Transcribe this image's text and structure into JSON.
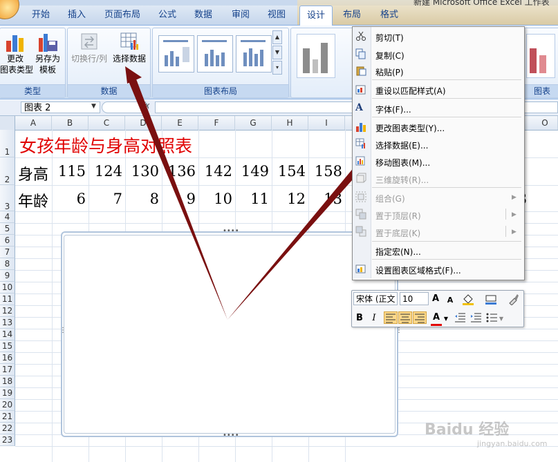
{
  "window": {
    "title_fragment": "新建 Microsoft Office Excel 工作表"
  },
  "tabs": [
    {
      "label": "开始"
    },
    {
      "label": "插入"
    },
    {
      "label": "页面布局"
    },
    {
      "label": "公式"
    },
    {
      "label": "数据"
    },
    {
      "label": "审阅"
    },
    {
      "label": "视图"
    },
    {
      "label": "设计"
    },
    {
      "label": "布局"
    },
    {
      "label": "格式"
    }
  ],
  "ribbon": {
    "type_group": {
      "label": "类型",
      "change_type": "更改\n图表类型",
      "save_template": "另存为\n模板"
    },
    "data_group": {
      "label": "数据",
      "switch_row_col": "切换行/列",
      "select_data": "选择数据"
    },
    "layout_group": {
      "label": "图表布局"
    },
    "styles_group_label_fragment": "图表"
  },
  "formula_bar": {
    "name_box": "图表 2",
    "fx": "fx",
    "value": ""
  },
  "sheet": {
    "columns": [
      "A",
      "B",
      "C",
      "D",
      "E",
      "F",
      "G",
      "H",
      "I",
      "",
      "",
      "",
      "",
      "",
      "O"
    ],
    "rows": [
      "1",
      "2",
      "3",
      "4",
      "5",
      "6",
      "7",
      "8",
      "9",
      "10",
      "11",
      "12",
      "13",
      "14",
      "15",
      "16",
      "17",
      "18",
      "19",
      "20",
      "21",
      "22",
      "23"
    ],
    "title": "女孩年龄与身高对照表",
    "height_label": "身高",
    "heights": [
      "115",
      "124",
      "130",
      "136",
      "142",
      "149",
      "154",
      "158"
    ],
    "age_label": "年龄",
    "ages": [
      "6",
      "7",
      "8",
      "9",
      "10",
      "11",
      "12",
      "13"
    ],
    "trailing_fragment": "8"
  },
  "context_menu": {
    "items": [
      {
        "label": "剪切(T)",
        "disabled": false,
        "icon": "scissors-icon"
      },
      {
        "label": "复制(C)",
        "disabled": false,
        "icon": "copy-icon"
      },
      {
        "label": "粘贴(P)",
        "disabled": false,
        "icon": "paste-icon"
      },
      {
        "label": "重设以匹配样式(A)",
        "disabled": false,
        "icon": "reset-style-icon"
      },
      {
        "label": "字体(F)...",
        "disabled": false,
        "icon": "font-icon"
      },
      {
        "label": "更改图表类型(Y)...",
        "disabled": false,
        "icon": "chart-type-icon"
      },
      {
        "label": "选择数据(E)...",
        "disabled": false,
        "icon": "select-data-icon"
      },
      {
        "label": "移动图表(M)...",
        "disabled": false,
        "icon": "move-chart-icon"
      },
      {
        "label": "三维旋转(R)...",
        "disabled": true,
        "icon": "3d-rotate-icon"
      },
      {
        "label": "组合(G)",
        "disabled": true,
        "icon": "group-icon"
      },
      {
        "label": "置于顶层(R)",
        "disabled": true,
        "icon": "bring-front-icon"
      },
      {
        "label": "置于底层(K)",
        "disabled": true,
        "icon": "send-back-icon"
      },
      {
        "label": "指定宏(N)...",
        "disabled": false,
        "icon": "macro-icon"
      },
      {
        "label": "设置图表区域格式(F)...",
        "disabled": false,
        "icon": "format-area-icon"
      }
    ]
  },
  "mini_toolbar": {
    "font_name": "宋体 (正文",
    "font_size": "10",
    "grow_font": "A",
    "shrink_font": "A",
    "bold": "B",
    "italic": "I",
    "font_color": "A"
  },
  "watermark": {
    "brand": "Baidu 经验",
    "sub": "jingyan.baidu.com"
  },
  "colors": {
    "arrow": "#7a1010",
    "title_red": "#e00000",
    "ribbon_blue": "#15428b"
  }
}
